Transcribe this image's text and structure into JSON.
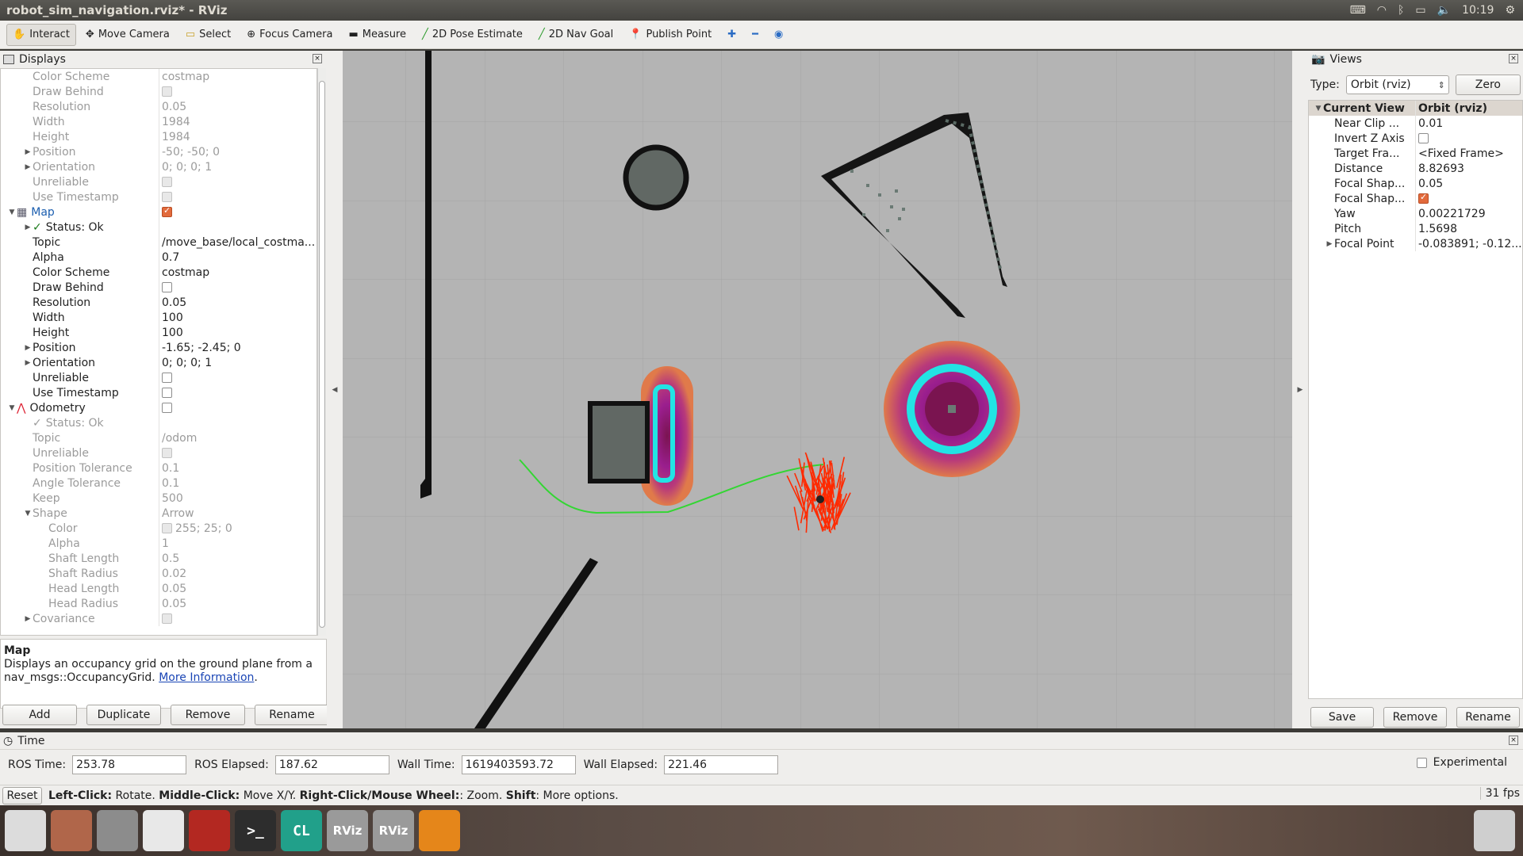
{
  "window": {
    "title": "robot_sim_navigation.rviz* - RViz",
    "clock": "10:19"
  },
  "toolbar": [
    {
      "label": "Interact",
      "icon": "hand-icon",
      "active": true
    },
    {
      "label": "Move Camera",
      "icon": "move-camera-icon"
    },
    {
      "label": "Select",
      "icon": "select-icon"
    },
    {
      "label": "Focus Camera",
      "icon": "focus-camera-icon"
    },
    {
      "label": "Measure",
      "icon": "measure-icon"
    },
    {
      "label": "2D Pose Estimate",
      "icon": "pose-estimate-icon"
    },
    {
      "label": "2D Nav Goal",
      "icon": "nav-goal-icon"
    },
    {
      "label": "Publish Point",
      "icon": "publish-point-icon"
    }
  ],
  "displays": {
    "title": "Displays",
    "rows": [
      {
        "label": "Color Scheme",
        "value": "costmap",
        "dis": true,
        "indent": 1
      },
      {
        "label": "Draw Behind",
        "check": "off",
        "dis": true,
        "indent": 1
      },
      {
        "label": "Resolution",
        "value": "0.05",
        "dis": true,
        "indent": 1
      },
      {
        "label": "Width",
        "value": "1984",
        "dis": true,
        "indent": 1
      },
      {
        "label": "Height",
        "value": "1984",
        "dis": true,
        "indent": 1
      },
      {
        "label": "Position",
        "value": "-50; -50; 0",
        "dis": true,
        "indent": 1,
        "arrow": "▶"
      },
      {
        "label": "Orientation",
        "value": "0; 0; 0; 1",
        "dis": true,
        "indent": 1,
        "arrow": "▶"
      },
      {
        "label": "Unreliable",
        "check": "off",
        "dis": true,
        "indent": 1
      },
      {
        "label": "Use Timestamp",
        "check": "off",
        "dis": true,
        "indent": 1
      },
      {
        "label": "Map",
        "check": "on",
        "indent": 0,
        "arrow": "▼",
        "sel": true,
        "icon": "map-icon"
      },
      {
        "label": "Status: Ok",
        "indent": 1,
        "arrow": "▶",
        "status": true
      },
      {
        "label": "Topic",
        "value": "/move_base/local_costma...",
        "indent": 1
      },
      {
        "label": "Alpha",
        "value": "0.7",
        "indent": 1
      },
      {
        "label": "Color Scheme",
        "value": "costmap",
        "indent": 1
      },
      {
        "label": "Draw Behind",
        "check": "off",
        "indent": 1
      },
      {
        "label": "Resolution",
        "value": "0.05",
        "indent": 1
      },
      {
        "label": "Width",
        "value": "100",
        "indent": 1
      },
      {
        "label": "Height",
        "value": "100",
        "indent": 1
      },
      {
        "label": "Position",
        "value": "-1.65; -2.45; 0",
        "indent": 1,
        "arrow": "▶"
      },
      {
        "label": "Orientation",
        "value": "0; 0; 0; 1",
        "indent": 1,
        "arrow": "▶"
      },
      {
        "label": "Unreliable",
        "check": "off",
        "indent": 1
      },
      {
        "label": "Use Timestamp",
        "check": "off",
        "indent": 1
      },
      {
        "label": "Odometry",
        "check": "off",
        "indent": 0,
        "arrow": "▼",
        "icon": "odometry-icon"
      },
      {
        "label": "Status: Ok",
        "indent": 1,
        "dis": true,
        "status": true
      },
      {
        "label": "Topic",
        "value": "/odom",
        "dis": true,
        "indent": 1
      },
      {
        "label": "Unreliable",
        "check": "off",
        "dis": true,
        "indent": 1
      },
      {
        "label": "Position Tolerance",
        "value": "0.1",
        "dis": true,
        "indent": 1
      },
      {
        "label": "Angle Tolerance",
        "value": "0.1",
        "dis": true,
        "indent": 1
      },
      {
        "label": "Keep",
        "value": "500",
        "dis": true,
        "indent": 1
      },
      {
        "label": "Shape",
        "value": "Arrow",
        "dis": true,
        "indent": 1,
        "arrow": "▼"
      },
      {
        "label": "Color",
        "value": "255; 25; 0",
        "dis": true,
        "indent": 2,
        "swatch": true
      },
      {
        "label": "Alpha",
        "value": "1",
        "dis": true,
        "indent": 2
      },
      {
        "label": "Shaft Length",
        "value": "0.5",
        "dis": true,
        "indent": 2
      },
      {
        "label": "Shaft Radius",
        "value": "0.02",
        "dis": true,
        "indent": 2
      },
      {
        "label": "Head Length",
        "value": "0.05",
        "dis": true,
        "indent": 2
      },
      {
        "label": "Head Radius",
        "value": "0.05",
        "dis": true,
        "indent": 2
      },
      {
        "label": "Covariance",
        "check": "off",
        "dis": true,
        "indent": 1,
        "arrow": "▶"
      }
    ],
    "desc_title": "Map",
    "desc_text": "Displays an occupancy grid on the ground plane from a nav_msgs::OccupancyGrid. ",
    "desc_link": "More Information",
    "buttons": [
      "Add",
      "Duplicate",
      "Remove",
      "Rename"
    ]
  },
  "views": {
    "title": "Views",
    "type_label": "Type:",
    "type_value": "Orbit (rviz)",
    "zero_label": "Zero",
    "header": {
      "label": "Current View",
      "value": "Orbit (rviz)"
    },
    "rows": [
      {
        "label": "Near Clip ...",
        "value": "0.01"
      },
      {
        "label": "Invert Z Axis",
        "check": "off"
      },
      {
        "label": "Target Fra...",
        "value": "<Fixed Frame>"
      },
      {
        "label": "Distance",
        "value": "8.82693"
      },
      {
        "label": "Focal Shap...",
        "value": "0.05"
      },
      {
        "label": "Focal Shap...",
        "check": "on"
      },
      {
        "label": "Yaw",
        "value": "0.00221729"
      },
      {
        "label": "Pitch",
        "value": "1.5698"
      },
      {
        "label": "Focal Point",
        "value": "-0.083891; -0.12...",
        "arrow": "▶"
      }
    ],
    "buttons": [
      "Save",
      "Remove",
      "Rename"
    ]
  },
  "time": {
    "title": "Time",
    "ros_time_label": "ROS Time:",
    "ros_time": "253.78",
    "ros_elapsed_label": "ROS Elapsed:",
    "ros_elapsed": "187.62",
    "wall_time_label": "Wall Time:",
    "wall_time": "1619403593.72",
    "wall_elapsed_label": "Wall Elapsed:",
    "wall_elapsed": "221.46",
    "experimental": "Experimental"
  },
  "status": {
    "reset": "Reset",
    "parts": [
      {
        "b": "Left-Click:",
        "t": " Rotate. "
      },
      {
        "b": "Middle-Click:",
        "t": " Move X/Y. "
      },
      {
        "b": "Right-Click/Mouse Wheel:",
        "t": ": Zoom. "
      },
      {
        "b": "Shift",
        "t": ": More options."
      }
    ],
    "fps": "31 fps"
  },
  "launcher": [
    {
      "name": "ubuntu-dash-icon",
      "label": "",
      "color": "#dcdcdc"
    },
    {
      "name": "files-icon",
      "label": "",
      "color": "#b0664a"
    },
    {
      "name": "settings-icon",
      "label": "",
      "color": "#8c8c8c"
    },
    {
      "name": "chrome-icon",
      "label": "",
      "color": "#e8e8e8"
    },
    {
      "name": "workspace-icon",
      "label": "",
      "color": "#b32821"
    },
    {
      "name": "terminal-icon",
      "label": ">_",
      "color": "#2d2d2d"
    },
    {
      "name": "clion-icon",
      "label": "CL",
      "color": "#21a08a"
    },
    {
      "name": "rviz-icon",
      "label": "RViz",
      "color": "#9a9a9a"
    },
    {
      "name": "rviz-icon",
      "label": "RViz",
      "color": "#9a9a9a"
    },
    {
      "name": "sublime-icon",
      "label": "",
      "color": "#e5861a"
    },
    {
      "name": "trash-icon",
      "label": "",
      "color": "#cfcfcf"
    }
  ],
  "colors": {
    "accent": "#e26a3c",
    "path": "#33d633",
    "particles": "#ff2a00",
    "costmap_ring": "#22e4e4",
    "costmap_mid": "#9a1e8e"
  }
}
